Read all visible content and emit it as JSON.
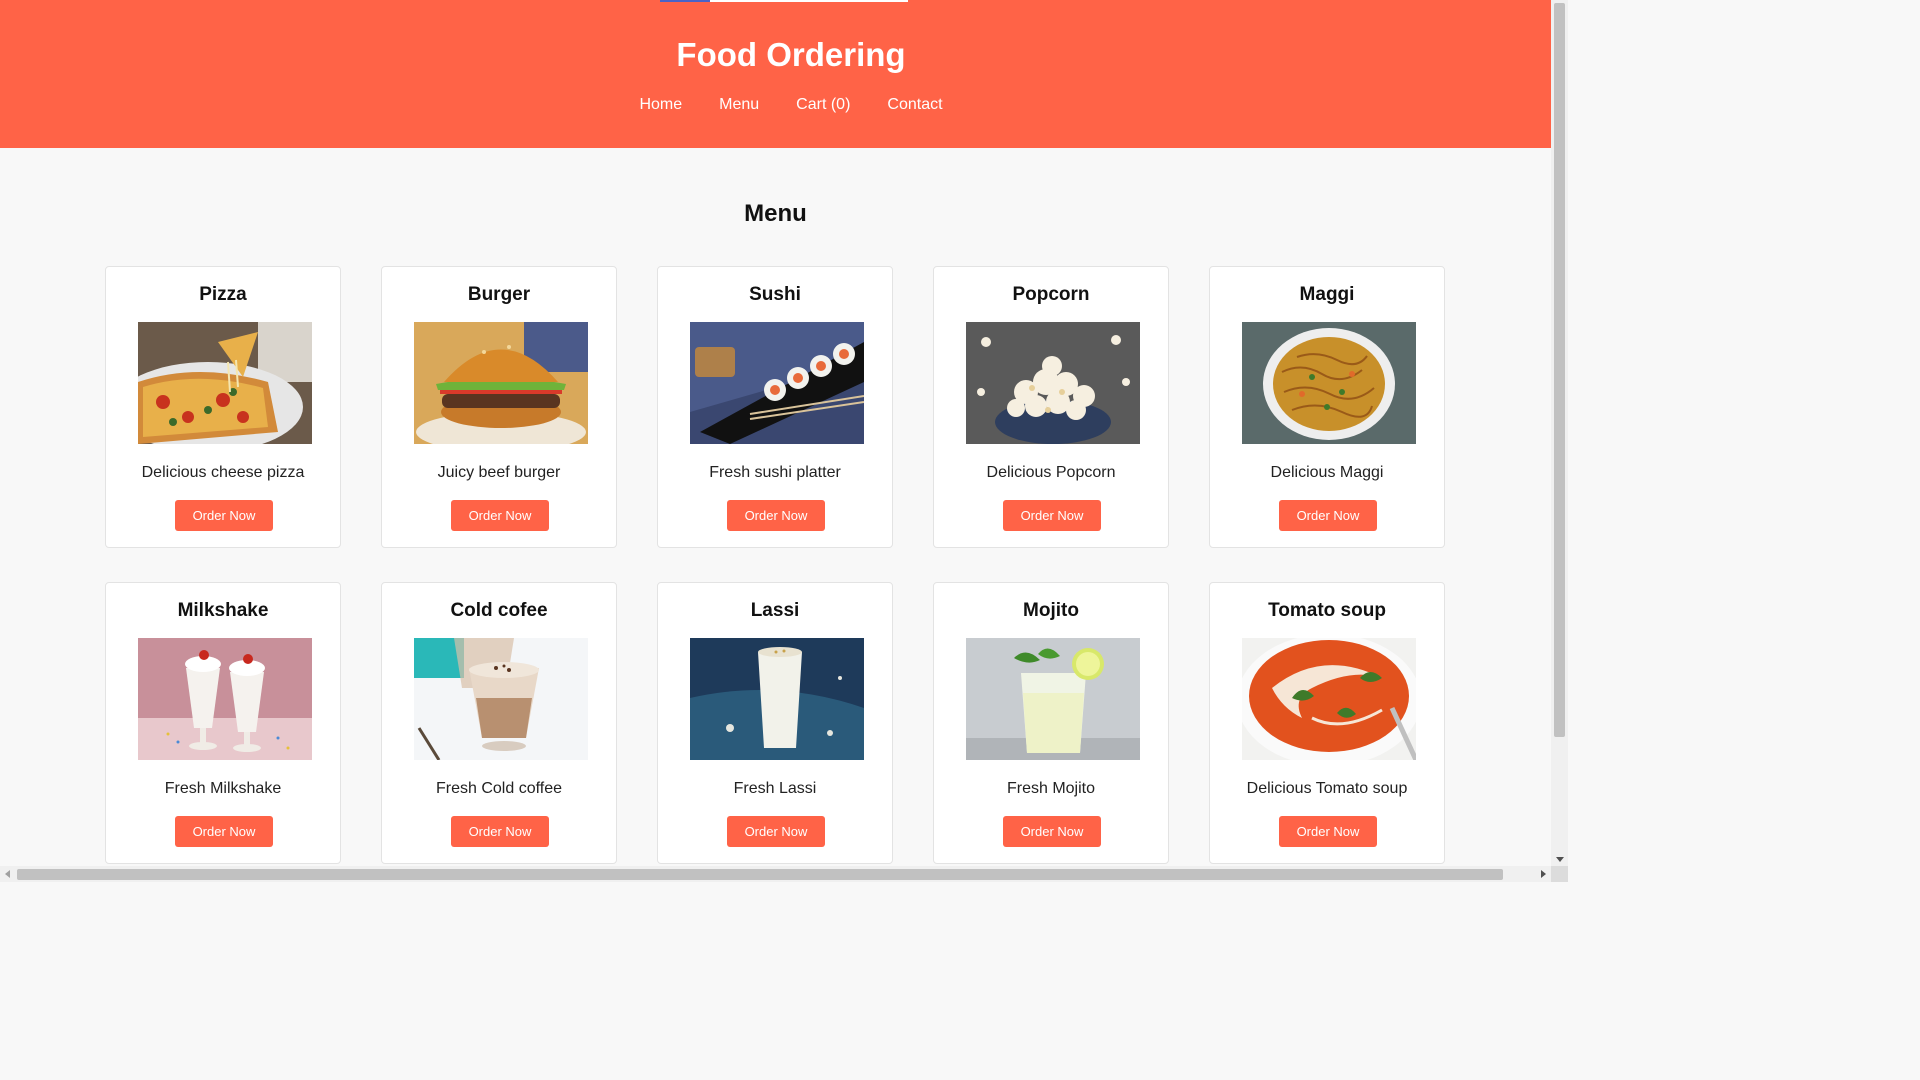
{
  "header": {
    "title": "Food Ordering",
    "nav": [
      "Home",
      "Menu",
      "Cart (0)",
      "Contact"
    ],
    "accent_color": "#ff6347"
  },
  "main": {
    "section_title": "Menu",
    "button_label": "Order Now",
    "items": [
      {
        "name": "Pizza",
        "description": "Delicious cheese pizza",
        "image": "pizza-photo"
      },
      {
        "name": "Burger",
        "description": "Juicy beef burger",
        "image": "burger-photo"
      },
      {
        "name": "Sushi",
        "description": "Fresh sushi platter",
        "image": "sushi-photo"
      },
      {
        "name": "Popcorn",
        "description": "Delicious Popcorn",
        "image": "popcorn-photo"
      },
      {
        "name": "Maggi",
        "description": "Delicious Maggi",
        "image": "maggi-photo"
      },
      {
        "name": "Milkshake",
        "description": "Fresh Milkshake",
        "image": "milkshake-photo"
      },
      {
        "name": "Cold cofee",
        "description": "Fresh Cold coffee",
        "image": "cold-coffee-photo"
      },
      {
        "name": "Lassi",
        "description": "Fresh Lassi",
        "image": "lassi-photo"
      },
      {
        "name": "Mojito",
        "description": "Fresh Mojito",
        "image": "mojito-photo"
      },
      {
        "name": "Tomato soup",
        "description": "Delicious Tomato soup",
        "image": "tomato-soup-photo"
      }
    ]
  }
}
